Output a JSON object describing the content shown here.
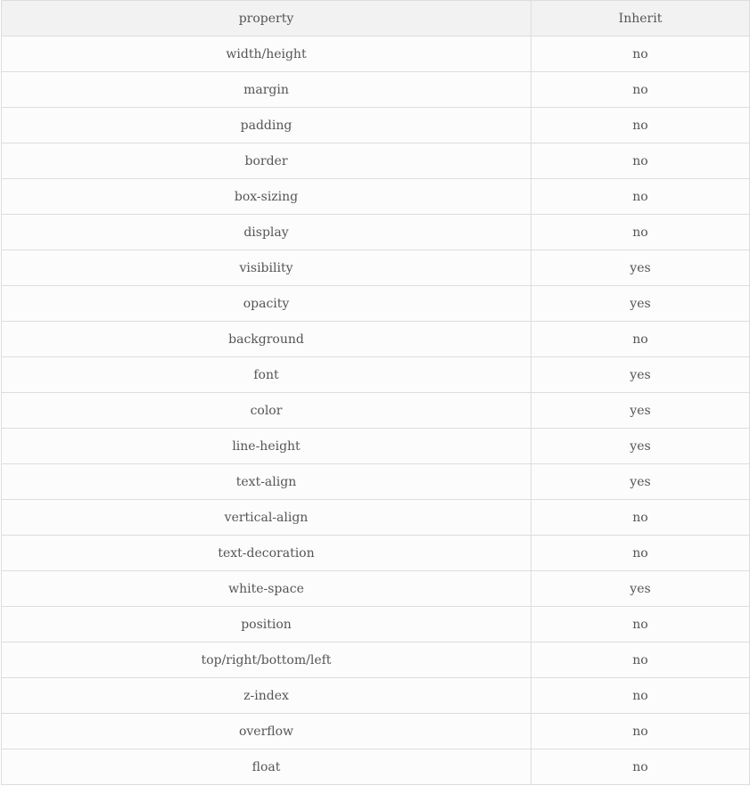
{
  "table": {
    "headers": [
      "property",
      "Inherit"
    ],
    "rows": [
      [
        "width/height",
        "no"
      ],
      [
        "margin",
        "no"
      ],
      [
        "padding",
        "no"
      ],
      [
        "border",
        "no"
      ],
      [
        "box-sizing",
        "no"
      ],
      [
        "display",
        "no"
      ],
      [
        "visibility",
        "yes"
      ],
      [
        "opacity",
        "yes"
      ],
      [
        "background",
        "no"
      ],
      [
        "font",
        "yes"
      ],
      [
        "color",
        "yes"
      ],
      [
        "line-height",
        "yes"
      ],
      [
        "text-align",
        "yes"
      ],
      [
        "vertical-align",
        "no"
      ],
      [
        "text-decoration",
        "no"
      ],
      [
        "white-space",
        "yes"
      ],
      [
        "position",
        "no"
      ],
      [
        "top/right/bottom/left",
        "no"
      ],
      [
        "z-index",
        "no"
      ],
      [
        "overflow",
        "no"
      ],
      [
        "float",
        "no"
      ]
    ]
  },
  "colors": {
    "header_background": "#f2f2f2",
    "row_background": "#fcfcfc",
    "border": "#dddddd",
    "text": "#555555"
  }
}
